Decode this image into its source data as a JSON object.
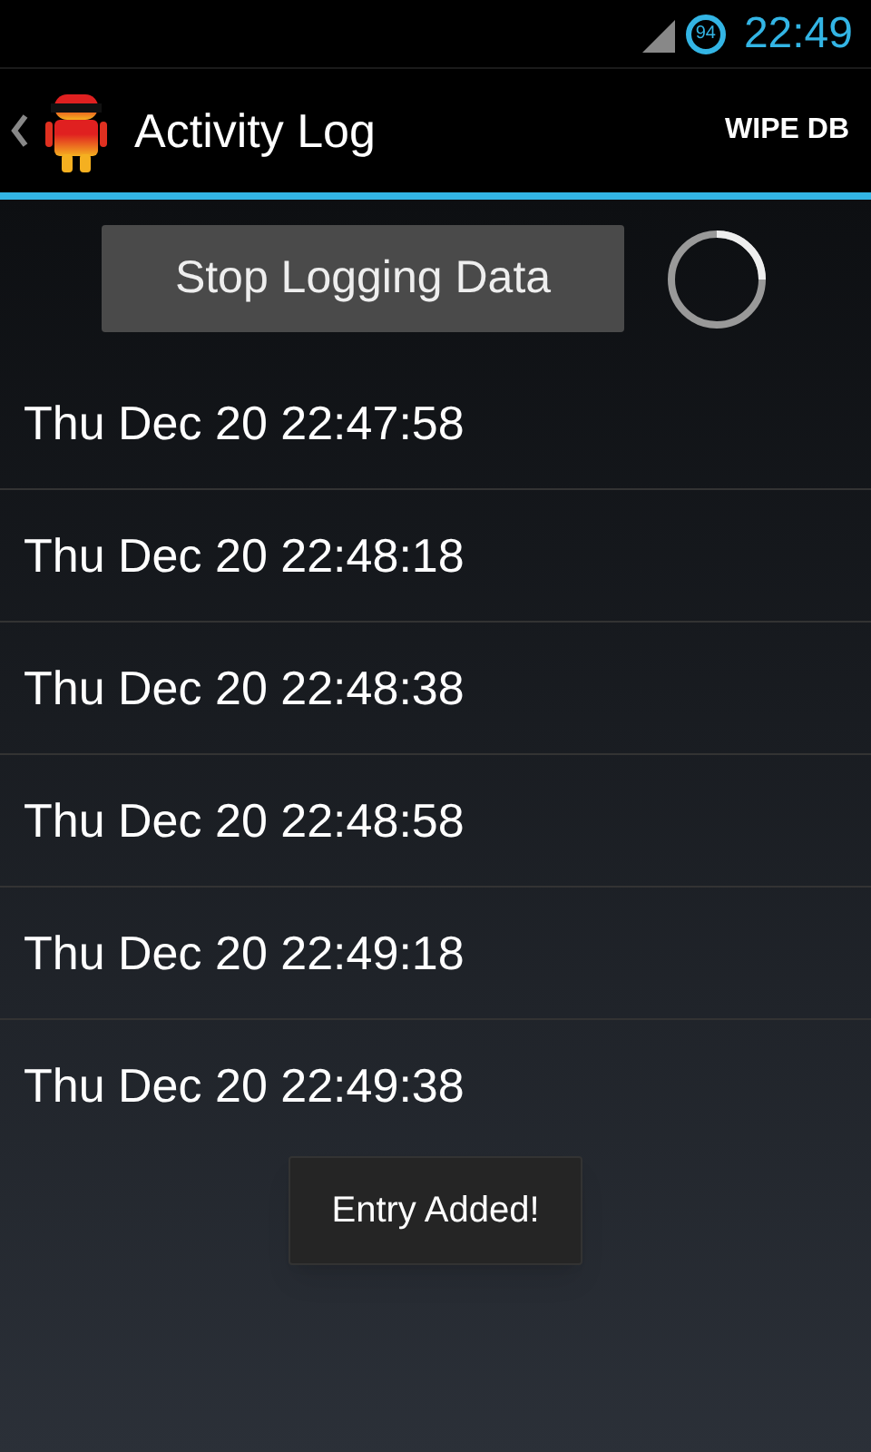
{
  "status_bar": {
    "battery": "94",
    "time": "22:49"
  },
  "action_bar": {
    "title": "Activity Log",
    "action": "WIPE DB"
  },
  "controls": {
    "button": "Stop Logging Data"
  },
  "entries": [
    "Thu Dec 20 22:47:58",
    "Thu Dec 20 22:48:18",
    "Thu Dec 20 22:48:38",
    "Thu Dec 20 22:48:58",
    "Thu Dec 20 22:49:18",
    "Thu Dec 20 22:49:38"
  ],
  "toast": "Entry Added!"
}
